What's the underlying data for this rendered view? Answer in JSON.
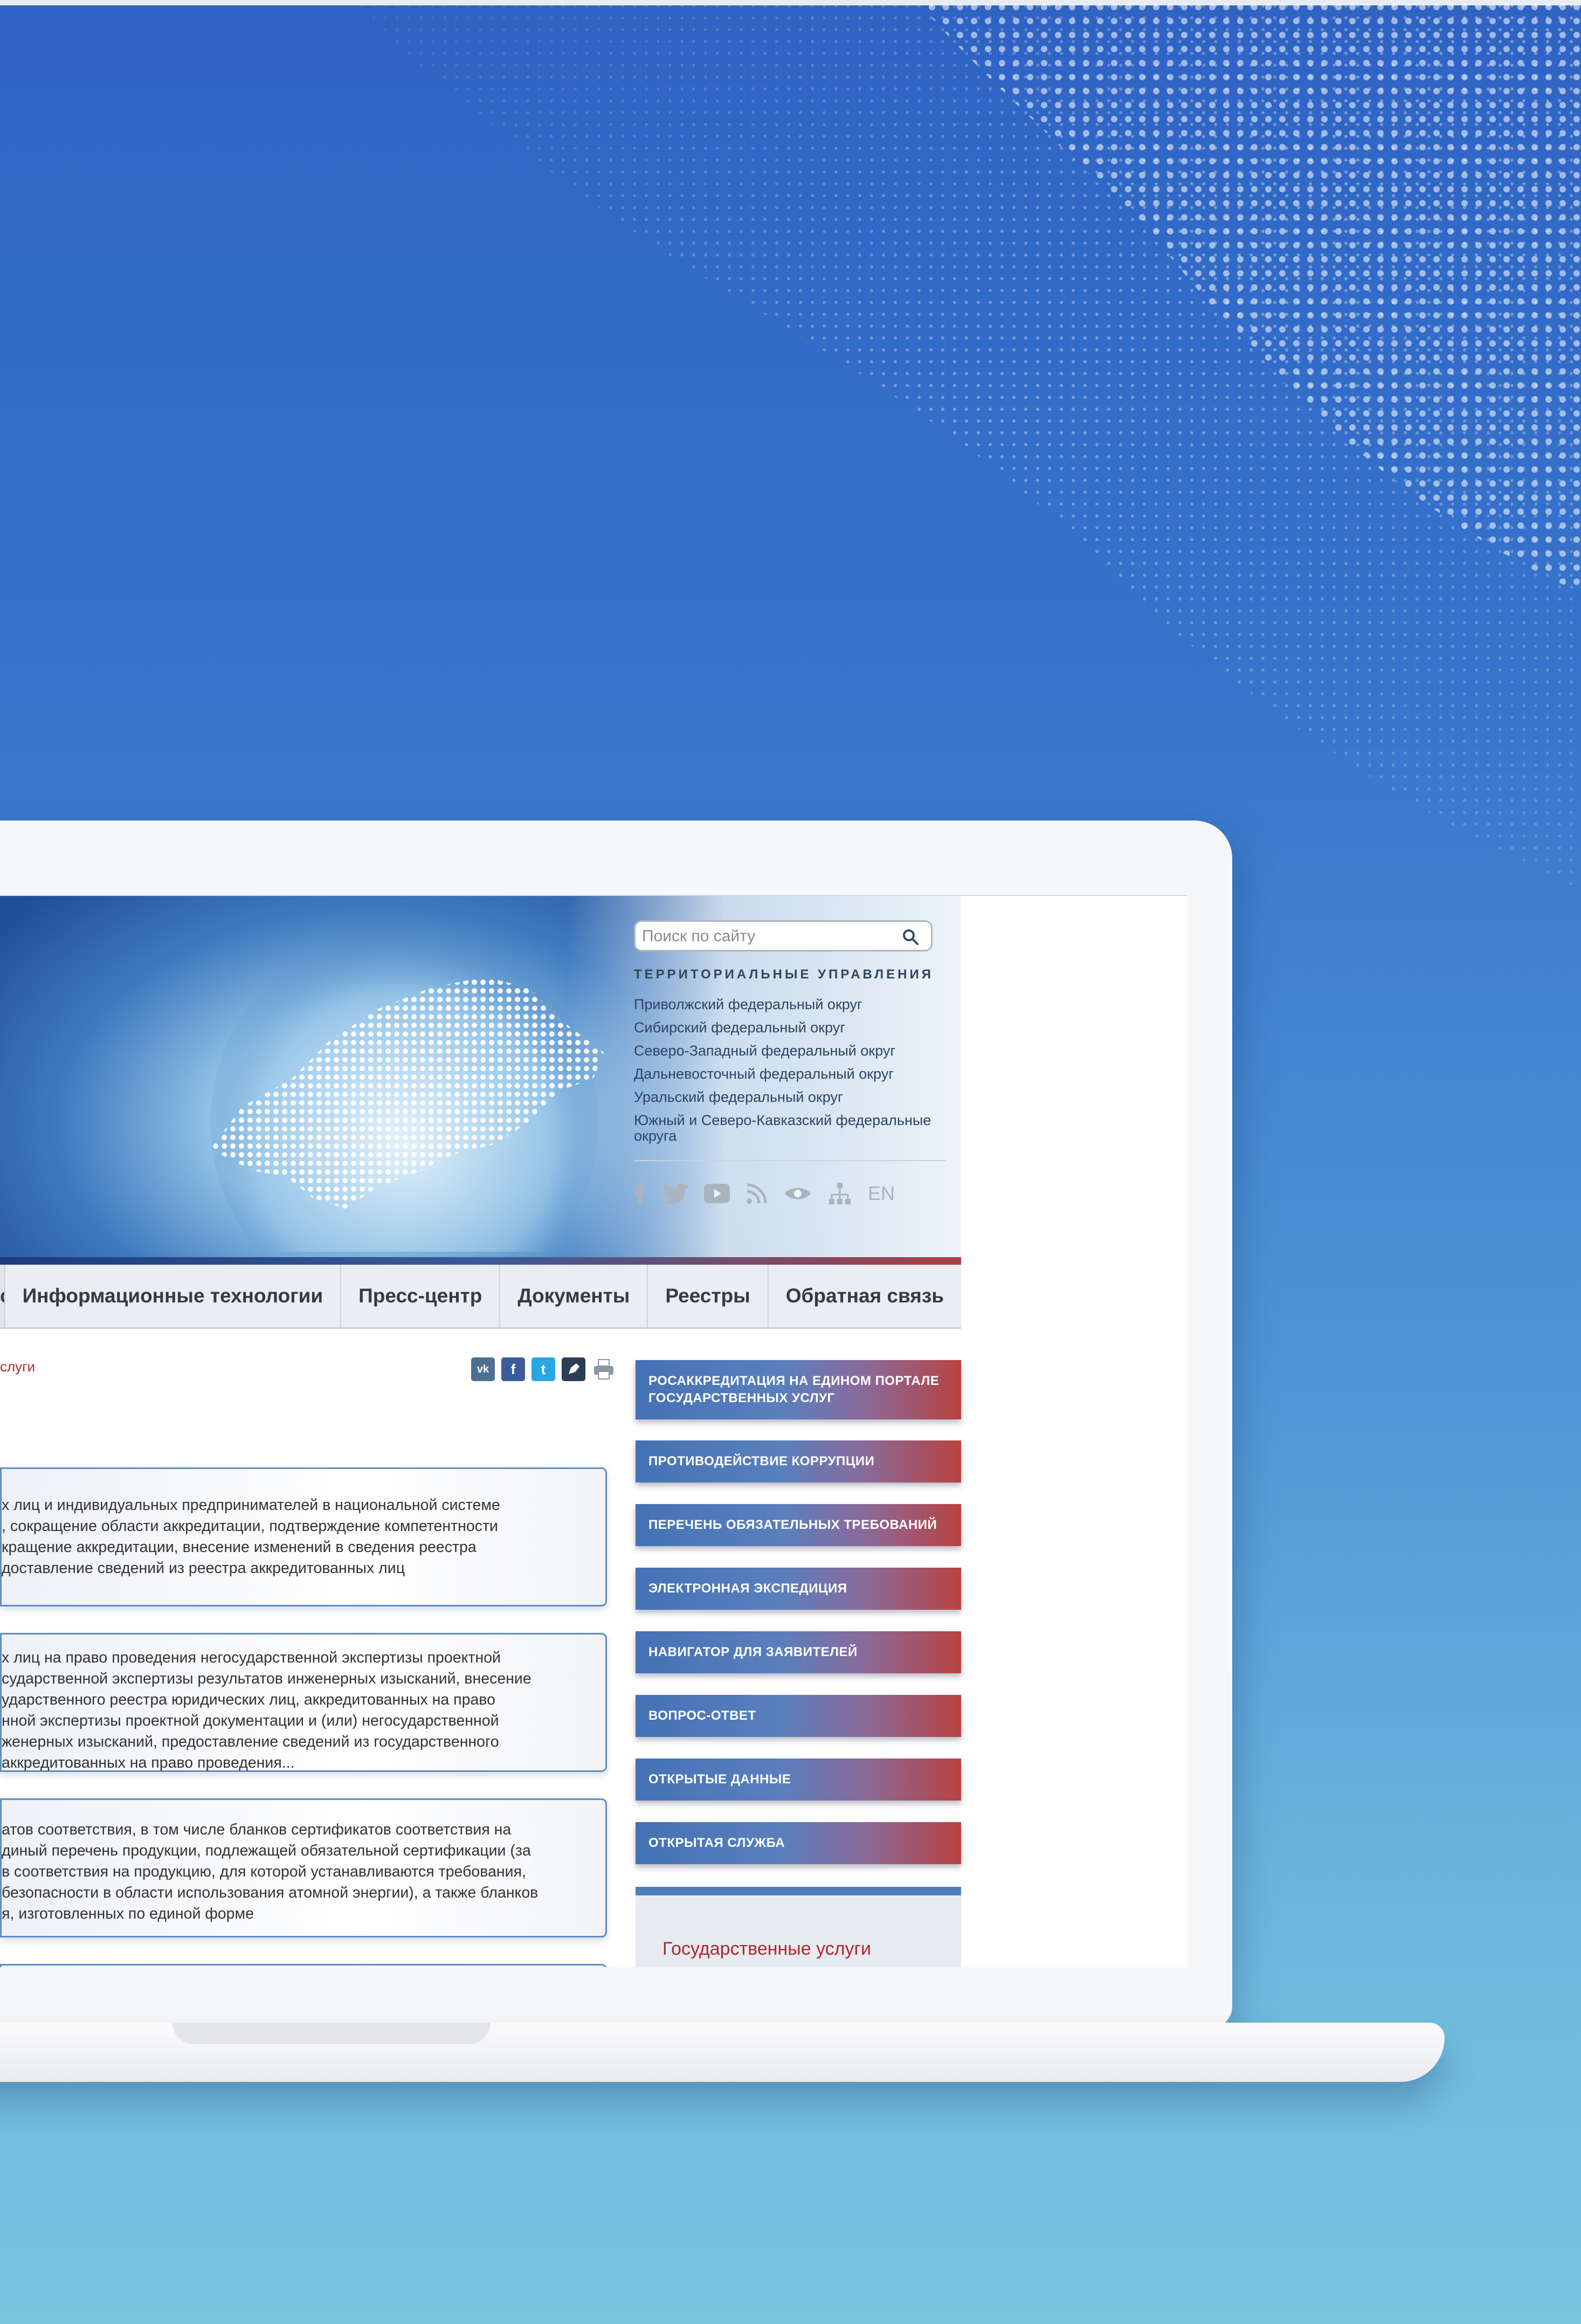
{
  "search": {
    "placeholder": "Поиск по сайту"
  },
  "territorial": {
    "title": "ТЕРРИТОРИАЛЬНЫЕ УПРАВЛЕНИЯ",
    "items": [
      "Приволжский федеральный округ",
      "Сибирский федеральный округ",
      "Северо-Западный федеральный округ",
      "Дальневосточный федеральный округ",
      "Уральский федеральный округ",
      "Южный и Северо-Кавказский федеральные округа"
    ]
  },
  "social": {
    "lang": "EN",
    "icons": [
      "facebook-icon",
      "twitter-icon",
      "youtube-icon",
      "rss-icon",
      "eye-icon",
      "sitemap-icon"
    ]
  },
  "nav": {
    "items": [
      "сть",
      "Информационные технологии",
      "Пресс-центр",
      "Документы",
      "Реестры",
      "Обратная связь"
    ]
  },
  "breadcrumb": "слуги",
  "share": {
    "vk": "vk",
    "fb": "f",
    "tw": "t"
  },
  "services": [
    "х лиц и индивидуальных предпринимателей в национальной системе\n, сокращение области аккредитации, подтверждение компетентности\nкращение аккредитации, внесение изменений в сведения реестра\nдоставление сведений из реестра аккредитованных лиц",
    "х лиц на право проведения негосударственной экспертизы проектной\nсударственной экспертизы результатов инженерных изысканий, внесение\nударственного реестра юридических лиц, аккредитованных на право\nнной экспертизы проектной документации и (или) негосударственной\nженерных изысканий, предоставление сведений из государственного\nаккредитованных на право проведения...",
    "атов соответствия, в том числе бланков сертификатов соответствия на\nдиный перечень продукции, подлежащей обязательной сертификации (за\nв соответствия на продукцию, для которой устанавливаются требования,\n безопасности в области использования атомной энергии), а также бланков\nя, изготовленных по единой форме"
  ],
  "sidebar": {
    "buttons": [
      "РОСАККРЕДИТАЦИЯ НА ЕДИНОМ ПОРТАЛЕ ГОСУДАРСТВЕННЫХ УСЛУГ",
      "ПРОТИВОДЕЙСТВИЕ КОРРУПЦИИ",
      "ПЕРЕЧЕНЬ ОБЯЗАТЕЛЬНЫХ ТРЕБОВАНИЙ",
      "ЭЛЕКТРОННАЯ ЭКСПЕДИЦИЯ",
      "НАВИГАТОР ДЛЯ ЗАЯВИТЕЛЕЙ",
      "ВОПРОС-ОТВЕТ",
      "ОТКРЫТЫЕ ДАННЫЕ",
      "ОТКРЫТАЯ СЛУЖБА"
    ],
    "gov_services_title": "Государственные услуги"
  }
}
